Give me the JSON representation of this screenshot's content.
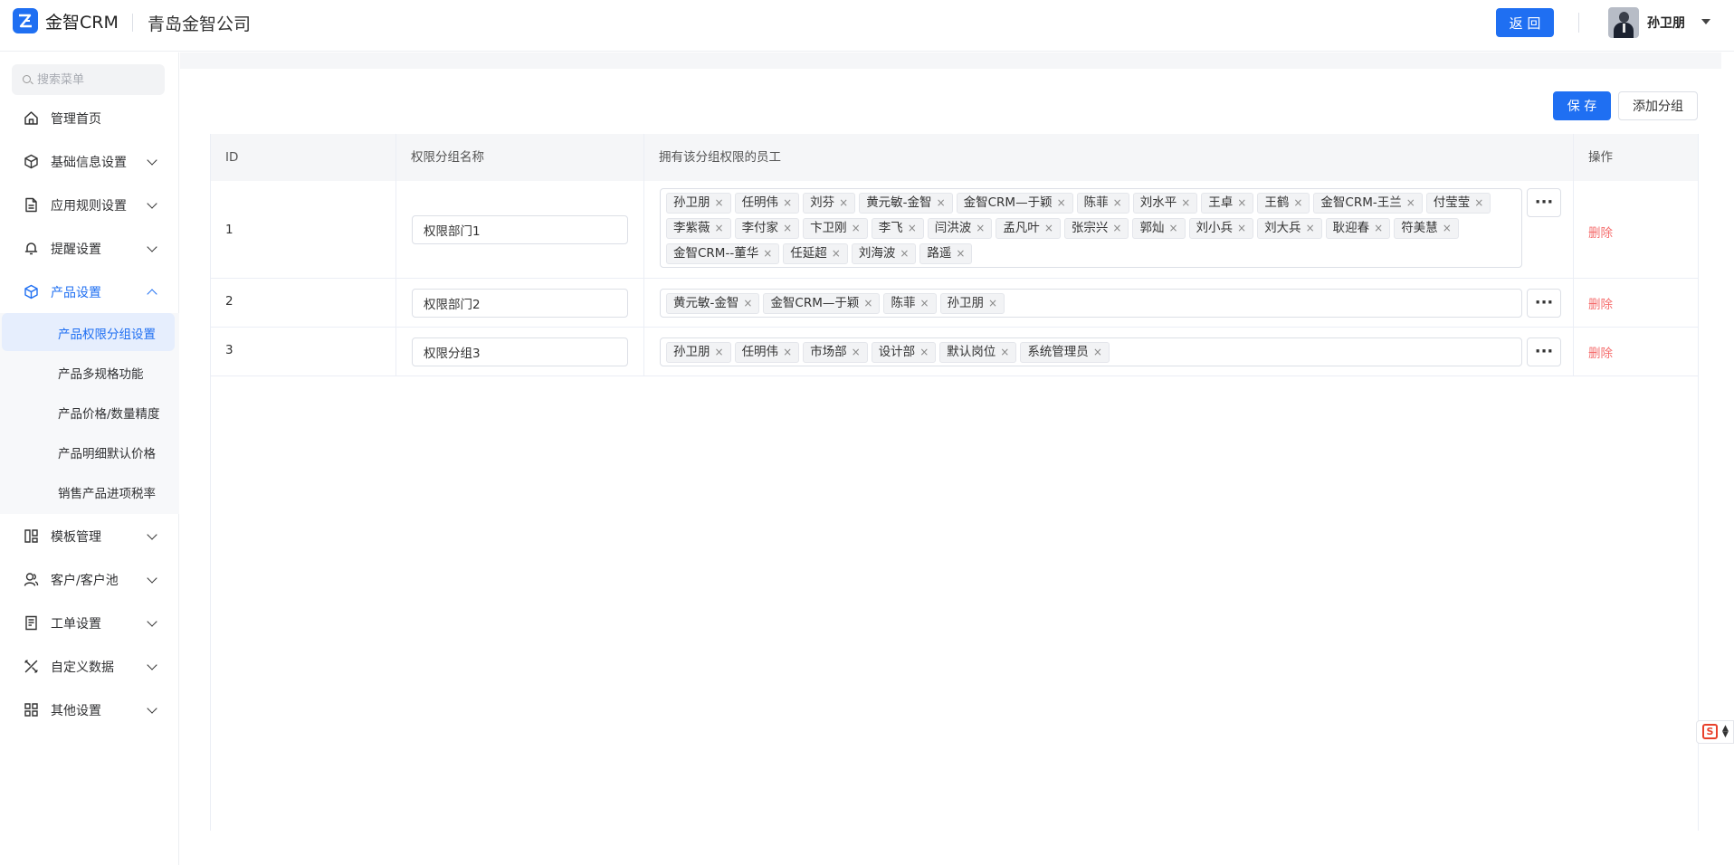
{
  "header": {
    "app_name": "金智CRM",
    "company": "青岛金智公司",
    "back_label": "返 回",
    "user_name": "孙卫朋"
  },
  "sidebar": {
    "search_placeholder": "搜索菜单",
    "items": [
      {
        "label": "管理首页",
        "icon": "home-icon"
      },
      {
        "label": "基础信息设置",
        "icon": "cube-icon"
      },
      {
        "label": "应用规则设置",
        "icon": "document-icon"
      },
      {
        "label": "提醒设置",
        "icon": "bell-icon"
      },
      {
        "label": "产品设置",
        "icon": "cube-icon"
      },
      {
        "label": "模板管理",
        "icon": "template-icon"
      },
      {
        "label": "客户/客户池",
        "icon": "users-icon"
      },
      {
        "label": "工单设置",
        "icon": "ticket-icon"
      },
      {
        "label": "自定义数据",
        "icon": "tools-icon"
      },
      {
        "label": "其他设置",
        "icon": "grid-icon"
      }
    ],
    "product_sub": [
      "产品权限分组设置",
      "产品多规格功能",
      "产品价格/数量精度",
      "产品明细默认价格",
      "销售产品进项税率"
    ]
  },
  "toolbar": {
    "save_label": "保 存",
    "add_group_label": "添加分组"
  },
  "table": {
    "headers": [
      "ID",
      "权限分组名称",
      "拥有该分组权限的员工",
      "操作"
    ],
    "rows": [
      {
        "id": "1",
        "name": "权限部门1",
        "members": [
          "孙卫朋",
          "任明伟",
          "刘芬",
          "黄元敏-金智",
          "金智CRM—于颖",
          "陈菲",
          "刘水平",
          "王卓",
          "王鹤",
          "金智CRM-王兰",
          "付莹莹",
          "李紫薇",
          "李付家",
          "卞卫刚",
          "李飞",
          "闫洪波",
          "孟凡叶",
          "张宗兴",
          "郭灿",
          "刘小兵",
          "刘大兵",
          "耿迎春",
          "符美慧",
          "金智CRM--董华",
          "任延超",
          "刘海波",
          "路遥"
        ],
        "action": "删除"
      },
      {
        "id": "2",
        "name": "权限部门2",
        "members": [
          "黄元敏-金智",
          "金智CRM—于颖",
          "陈菲",
          "孙卫朋"
        ],
        "action": "删除"
      },
      {
        "id": "3",
        "name": "权限分组3",
        "members": [
          "孙卫朋",
          "任明伟",
          "市场部",
          "设计部",
          "默认岗位",
          "系统管理员"
        ],
        "action": "删除"
      }
    ],
    "more_label": "···"
  },
  "colors": {
    "primary": "#1f6ff2",
    "danger": "#f56c6c"
  }
}
